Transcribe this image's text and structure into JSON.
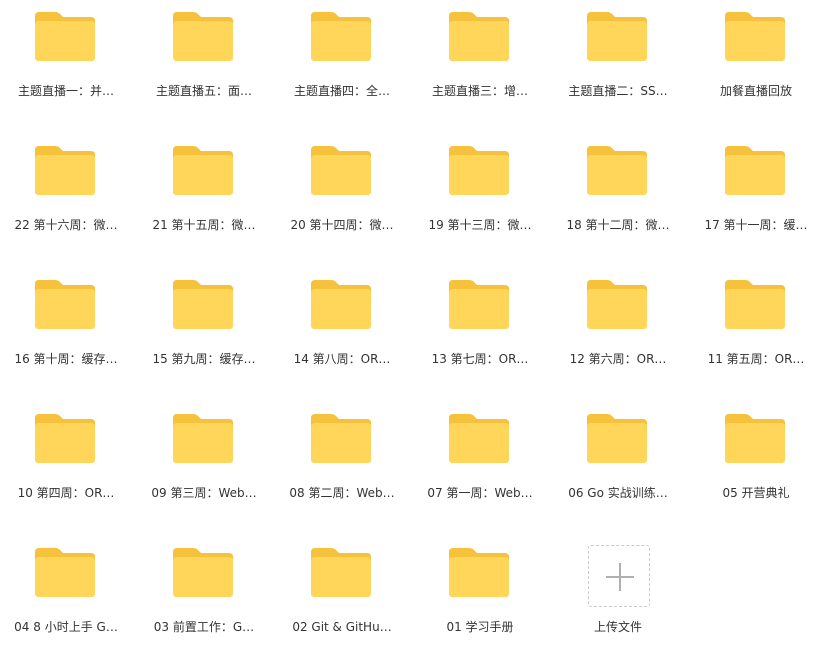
{
  "colors": {
    "folder_back": "#F6C23B",
    "folder_front": "#FFD659",
    "label": "#333333"
  },
  "items": [
    {
      "label": "主题直播一：并…"
    },
    {
      "label": "主题直播五：面…"
    },
    {
      "label": "主题直播四：全…"
    },
    {
      "label": "主题直播三：增…"
    },
    {
      "label": "主题直播二：SS…"
    },
    {
      "label": "加餐直播回放"
    },
    {
      "label": "22 第十六周：微…"
    },
    {
      "label": "21 第十五周：微…"
    },
    {
      "label": "20 第十四周：微…"
    },
    {
      "label": "19 第十三周：微…"
    },
    {
      "label": "18 第十二周：微…"
    },
    {
      "label": "17 第十一周：缓…"
    },
    {
      "label": "16 第十周：缓存…"
    },
    {
      "label": "15 第九周：缓存…"
    },
    {
      "label": "14 第八周：OR…"
    },
    {
      "label": "13 第七周：OR…"
    },
    {
      "label": "12 第六周：OR…"
    },
    {
      "label": "11 第五周：OR…"
    },
    {
      "label": "10 第四周：OR…"
    },
    {
      "label": "09 第三周：Web…"
    },
    {
      "label": "08 第二周：Web…"
    },
    {
      "label": "07 第一周：Web…"
    },
    {
      "label": "06 Go 实战训练…"
    },
    {
      "label": "05 开营典礼"
    },
    {
      "label": "04 8 小时上手 G…"
    },
    {
      "label": "03 前置工作：G…"
    },
    {
      "label": "02 Git & GitHu…"
    },
    {
      "label": "01 学习手册"
    }
  ],
  "upload": {
    "label": "上传文件",
    "icon": "plus-icon"
  }
}
